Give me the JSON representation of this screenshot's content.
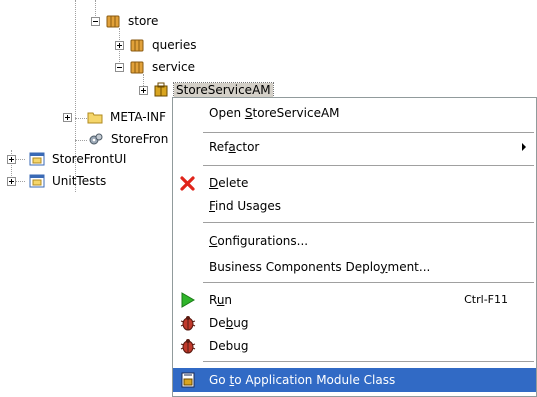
{
  "tree": {
    "store": "store",
    "queries": "queries",
    "service": "service",
    "store_service_am": "StoreServiceAM",
    "meta_inf": "META-INF",
    "storefront_partial": "StoreFron",
    "storefront_ui": "StoreFrontUI",
    "unit_tests": "UnitTests"
  },
  "menu": {
    "open": {
      "pre": "Open ",
      "u": "S",
      "post": "toreServiceAM"
    },
    "refactor": {
      "pre": "Ref",
      "u": "a",
      "post": "ctor"
    },
    "delete": {
      "pre": "",
      "u": "D",
      "post": "elete"
    },
    "find_usages": {
      "pre": "",
      "u": "F",
      "post": "ind Usages"
    },
    "configurations": {
      "pre": "",
      "u": "C",
      "post": "onfigurations..."
    },
    "deployment": {
      "pre": "Business Components Deplo",
      "u": "y",
      "post": "ment..."
    },
    "run": {
      "pre": "R",
      "u": "u",
      "post": "n",
      "shortcut": "Ctrl-F11"
    },
    "debug1": {
      "pre": "De",
      "u": "b",
      "post": "ug"
    },
    "debug2": {
      "pre": "Debu",
      "u": "g",
      "post": ""
    },
    "goto": {
      "pre": "Go ",
      "u": "t",
      "post": "o Application Module Class"
    }
  },
  "colors": {
    "highlight": "#316ac5",
    "folder": "#f5d66b",
    "package": "#e1a13a",
    "delete_red": "#e0241a",
    "run_green": "#2fb52a"
  },
  "icons": {
    "package": "package-icon",
    "folder": "folder-icon",
    "project": "project-icon",
    "app_module": "app-module-icon",
    "settings": "settings-icon",
    "delete": "delete-icon",
    "run": "run-icon",
    "debug": "bug-icon",
    "goto_class": "class-icon"
  }
}
